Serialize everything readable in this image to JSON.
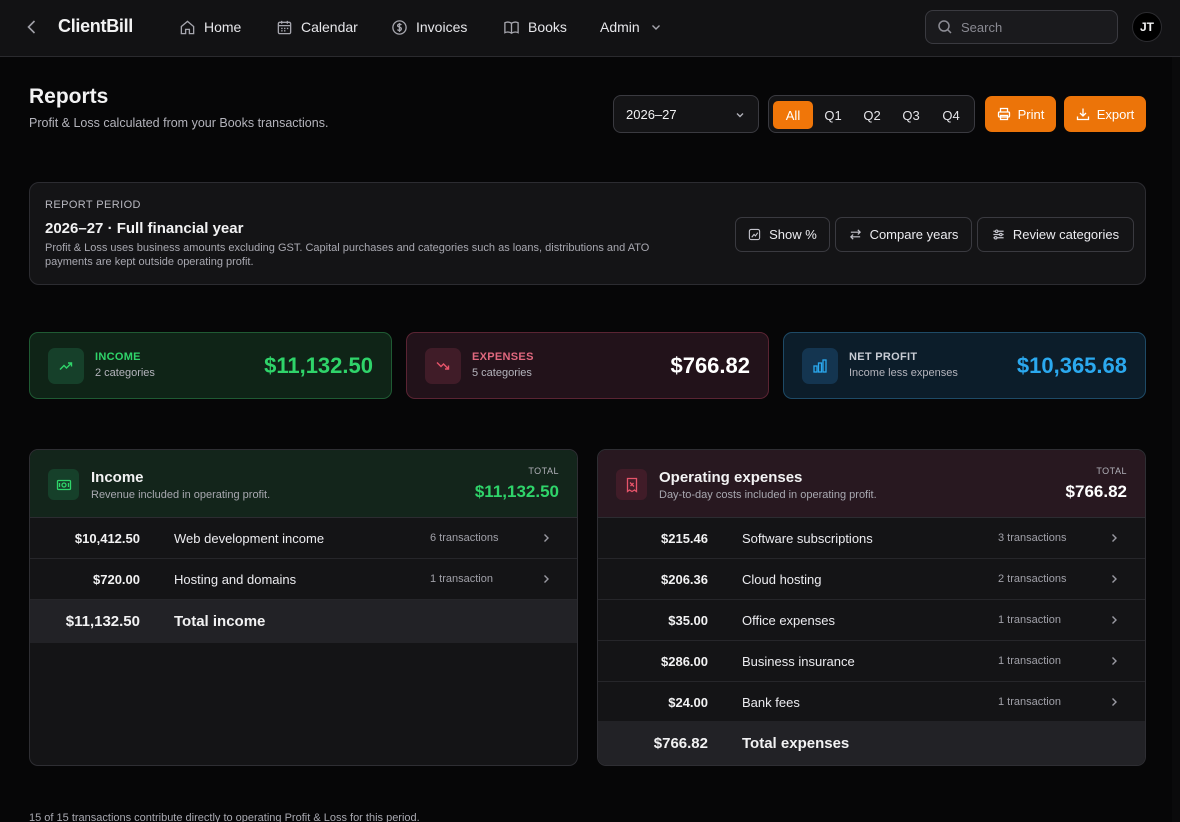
{
  "app": {
    "name": "ClientBill"
  },
  "nav": {
    "items": [
      {
        "label": "Home",
        "icon": "home-icon"
      },
      {
        "label": "Calendar",
        "icon": "calendar-icon"
      },
      {
        "label": "Invoices",
        "icon": "dollar-circle-icon"
      },
      {
        "label": "Books",
        "icon": "book-icon"
      },
      {
        "label": "Admin",
        "icon": "chevron-down-icon"
      }
    ],
    "search_placeholder": "Search",
    "avatar_initials": "JT"
  },
  "header": {
    "title": "Reports",
    "subtitle": "Profit & Loss calculated from your Books transactions.",
    "year_selected": "2026–27",
    "quarters": [
      "All",
      "Q1",
      "Q2",
      "Q3",
      "Q4"
    ],
    "quarter_active": "All",
    "print_label": "Print",
    "export_label": "Export"
  },
  "period": {
    "kicker": "REPORT PERIOD",
    "title": "2026–27 · Full financial year",
    "description": "Profit & Loss uses business amounts excluding GST. Capital purchases and categories such as loans, distributions and ATO payments are kept outside operating profit.",
    "show_pct_label": "Show %",
    "compare_label": "Compare years",
    "review_label": "Review categories"
  },
  "stats": {
    "income": {
      "label": "INCOME",
      "sub": "2 categories",
      "value": "$11,132.50",
      "color": "#2fd46a"
    },
    "expenses": {
      "label": "EXPENSES",
      "sub": "5 categories",
      "value": "$766.82",
      "color": "#ffffff"
    },
    "net": {
      "label": "NET PROFIT",
      "sub": "Income less expenses",
      "value": "$10,365.68",
      "color": "#2ba9ef"
    }
  },
  "income_table": {
    "title": "Income",
    "subtitle": "Revenue included in operating profit.",
    "total_label": "TOTAL",
    "total_value": "$11,132.50",
    "rows": [
      {
        "amount": "$10,412.50",
        "category": "Web development income",
        "transactions": "6 transactions"
      },
      {
        "amount": "$720.00",
        "category": "Hosting and domains",
        "transactions": "1 transaction"
      }
    ],
    "footer_amount": "$11,132.50",
    "footer_label": "Total income"
  },
  "expense_table": {
    "title": "Operating expenses",
    "subtitle": "Day-to-day costs included in operating profit.",
    "total_label": "TOTAL",
    "total_value": "$766.82",
    "rows": [
      {
        "amount": "$215.46",
        "category": "Software subscriptions",
        "transactions": "3 transactions"
      },
      {
        "amount": "$206.36",
        "category": "Cloud hosting",
        "transactions": "2 transactions"
      },
      {
        "amount": "$35.00",
        "category": "Office expenses",
        "transactions": "1 transaction"
      },
      {
        "amount": "$286.00",
        "category": "Business insurance",
        "transactions": "1 transaction"
      },
      {
        "amount": "$24.00",
        "category": "Bank fees",
        "transactions": "1 transaction"
      }
    ],
    "footer_amount": "$766.82",
    "footer_label": "Total expenses"
  },
  "footer_note": "15 of 15 transactions contribute directly to operating Profit & Loss for this period."
}
